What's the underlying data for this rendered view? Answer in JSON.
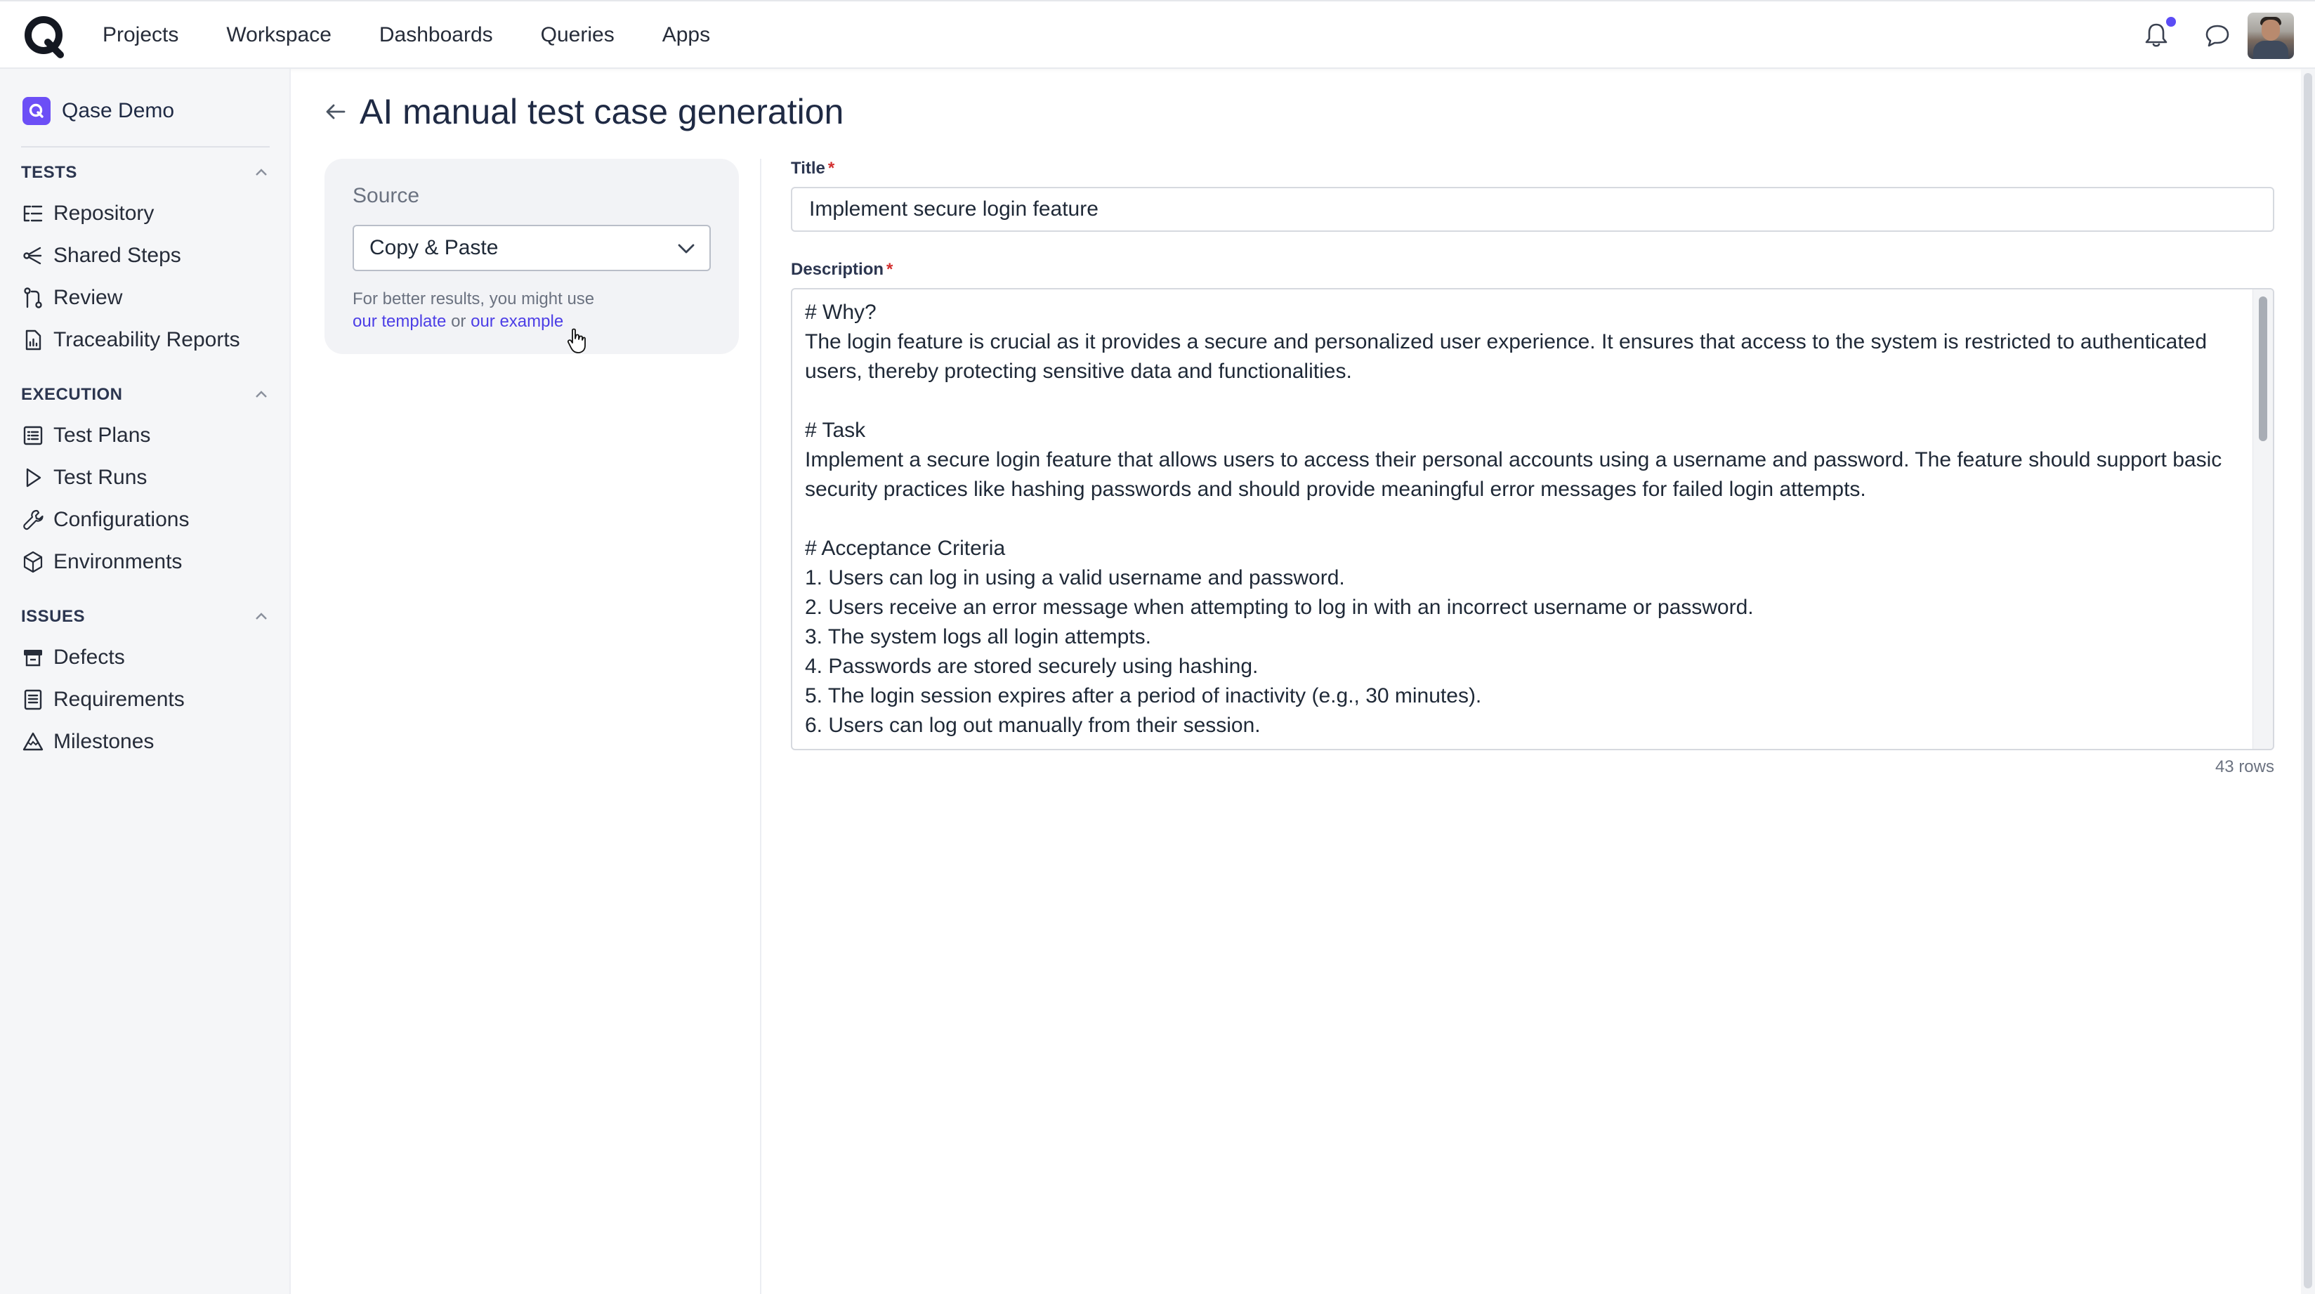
{
  "topbar": {
    "nav": [
      "Projects",
      "Workspace",
      "Dashboards",
      "Queries",
      "Apps"
    ],
    "icons": [
      "bell-icon",
      "chat-icon",
      "avatar"
    ],
    "notification_color": "#5b4cf5"
  },
  "sidebar": {
    "project_name": "Qase Demo",
    "sections": [
      {
        "title": "TESTS",
        "items": [
          {
            "label": "Repository",
            "icon": "repository-icon"
          },
          {
            "label": "Shared Steps",
            "icon": "shared-steps-icon"
          },
          {
            "label": "Review",
            "icon": "review-icon"
          },
          {
            "label": "Traceability Reports",
            "icon": "report-icon"
          }
        ]
      },
      {
        "title": "EXECUTION",
        "items": [
          {
            "label": "Test Plans",
            "icon": "test-plans-icon"
          },
          {
            "label": "Test Runs",
            "icon": "play-icon"
          },
          {
            "label": "Configurations",
            "icon": "wrench-icon"
          },
          {
            "label": "Environments",
            "icon": "cube-icon"
          }
        ]
      },
      {
        "title": "ISSUES",
        "items": [
          {
            "label": "Defects",
            "icon": "defects-icon"
          },
          {
            "label": "Requirements",
            "icon": "requirements-icon"
          },
          {
            "label": "Milestones",
            "icon": "milestone-icon"
          }
        ]
      }
    ]
  },
  "page": {
    "title": "AI manual test case generation"
  },
  "source": {
    "label": "Source",
    "selected": "Copy & Paste",
    "hint_text": "For better results, you might use",
    "link_template": "our template",
    "hint_or": "or",
    "link_example": "our example"
  },
  "form": {
    "title_label": "Title",
    "title_value": "Implement secure login feature",
    "description_label": "Description",
    "required_mark": "*",
    "description_lines": [
      "# Why?",
      "The login feature is crucial as it provides a secure and personalized user experience. It ensures that access to the system is restricted to authenticated",
      "users, thereby protecting sensitive data and functionalities.",
      "",
      "# Task",
      "Implement a secure login feature that allows users to access their personal accounts using a username and password. The feature should support basic",
      "security practices like hashing passwords and should provide meaningful error messages for failed login attempts.",
      "",
      "# Acceptance Criteria",
      "1. Users can log in using a valid username and password.",
      "2. Users receive an error message when attempting to log in with an incorrect username or password.",
      "3. The system logs all login attempts.",
      "4. Passwords are stored securely using hashing.",
      "5. The login session expires after a period of inactivity (e.g., 30 minutes).",
      "6. Users can log out manually from their session."
    ],
    "rows_count": "43 rows"
  }
}
